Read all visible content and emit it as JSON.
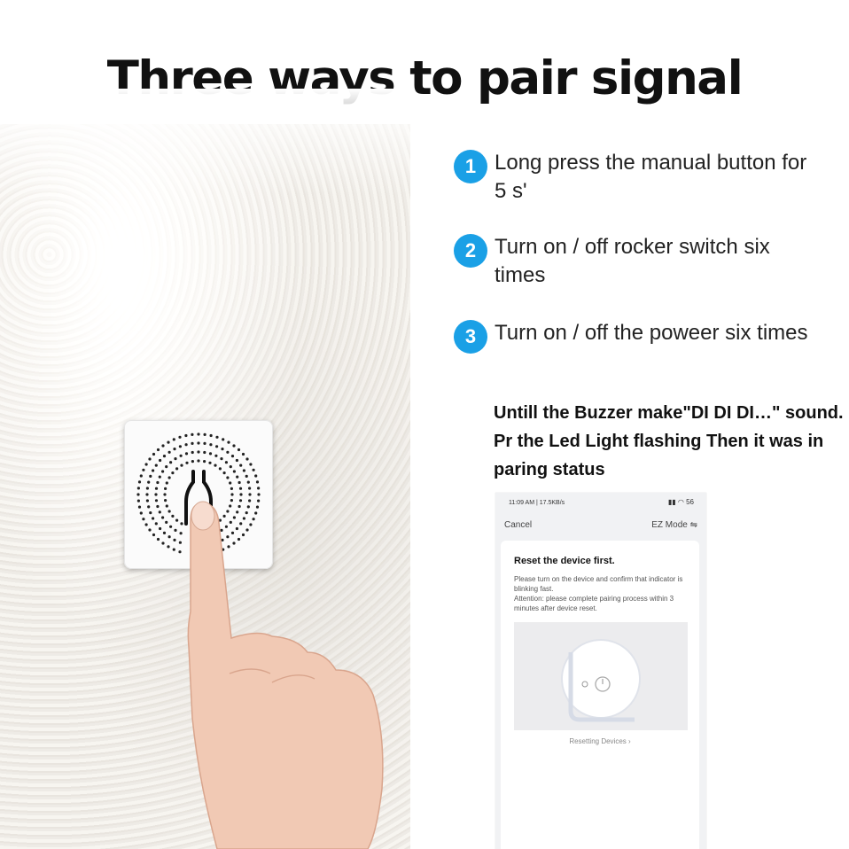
{
  "title": "Three ways to pair signal",
  "steps": [
    {
      "num": "1",
      "text": "Long press the manual button for 5 s'"
    },
    {
      "num": "2",
      "text": "Turn on / off rocker switch six times"
    },
    {
      "num": "3",
      "text": "Turn on / off the poweer six times"
    }
  ],
  "note": "Untill the Buzzer make\"DI DI DI…\" sound. Pr the Led Light flashing Then it was in paring status",
  "phone": {
    "status_time": "11:09 AM | 17.5KB/s",
    "status_icons": "56",
    "cancel": "Cancel",
    "mode": "EZ Mode",
    "card_title": "Reset the device first.",
    "card_text1": "Please turn on the device and confirm that indicator is blinking fast.",
    "card_text2": "Attention: please complete pairing process within 3 minutes after device reset.",
    "reset_link": "Resetting Devices"
  },
  "colors": {
    "accent": "#1aa0e6"
  },
  "icons": [
    "switch-illustration",
    "finger-image",
    "power-icon",
    "wifi-icon",
    "signal-icon",
    "battery-icon",
    "swap-icon"
  ]
}
